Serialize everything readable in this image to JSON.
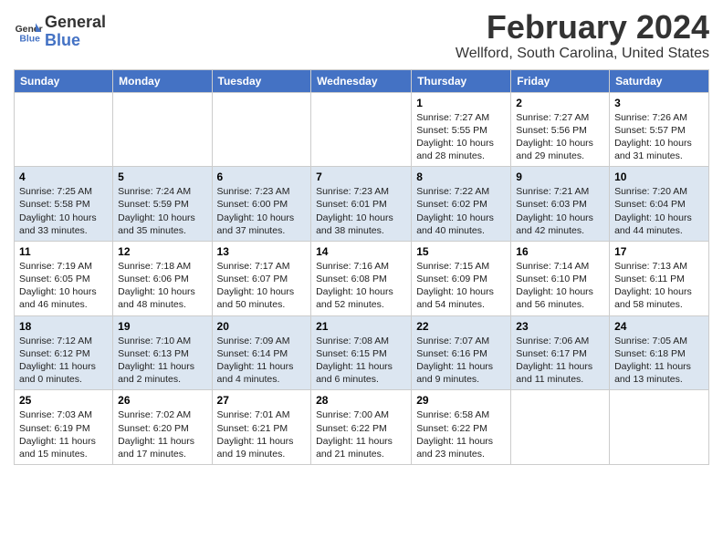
{
  "header": {
    "logo_line1": "General",
    "logo_line2": "Blue",
    "month": "February 2024",
    "location": "Wellford, South Carolina, United States"
  },
  "days_of_week": [
    "Sunday",
    "Monday",
    "Tuesday",
    "Wednesday",
    "Thursday",
    "Friday",
    "Saturday"
  ],
  "weeks": [
    [
      {
        "day": "",
        "content": ""
      },
      {
        "day": "",
        "content": ""
      },
      {
        "day": "",
        "content": ""
      },
      {
        "day": "",
        "content": ""
      },
      {
        "day": "1",
        "content": "Sunrise: 7:27 AM\nSunset: 5:55 PM\nDaylight: 10 hours and 28 minutes."
      },
      {
        "day": "2",
        "content": "Sunrise: 7:27 AM\nSunset: 5:56 PM\nDaylight: 10 hours and 29 minutes."
      },
      {
        "day": "3",
        "content": "Sunrise: 7:26 AM\nSunset: 5:57 PM\nDaylight: 10 hours and 31 minutes."
      }
    ],
    [
      {
        "day": "4",
        "content": "Sunrise: 7:25 AM\nSunset: 5:58 PM\nDaylight: 10 hours and 33 minutes."
      },
      {
        "day": "5",
        "content": "Sunrise: 7:24 AM\nSunset: 5:59 PM\nDaylight: 10 hours and 35 minutes."
      },
      {
        "day": "6",
        "content": "Sunrise: 7:23 AM\nSunset: 6:00 PM\nDaylight: 10 hours and 37 minutes."
      },
      {
        "day": "7",
        "content": "Sunrise: 7:23 AM\nSunset: 6:01 PM\nDaylight: 10 hours and 38 minutes."
      },
      {
        "day": "8",
        "content": "Sunrise: 7:22 AM\nSunset: 6:02 PM\nDaylight: 10 hours and 40 minutes."
      },
      {
        "day": "9",
        "content": "Sunrise: 7:21 AM\nSunset: 6:03 PM\nDaylight: 10 hours and 42 minutes."
      },
      {
        "day": "10",
        "content": "Sunrise: 7:20 AM\nSunset: 6:04 PM\nDaylight: 10 hours and 44 minutes."
      }
    ],
    [
      {
        "day": "11",
        "content": "Sunrise: 7:19 AM\nSunset: 6:05 PM\nDaylight: 10 hours and 46 minutes."
      },
      {
        "day": "12",
        "content": "Sunrise: 7:18 AM\nSunset: 6:06 PM\nDaylight: 10 hours and 48 minutes."
      },
      {
        "day": "13",
        "content": "Sunrise: 7:17 AM\nSunset: 6:07 PM\nDaylight: 10 hours and 50 minutes."
      },
      {
        "day": "14",
        "content": "Sunrise: 7:16 AM\nSunset: 6:08 PM\nDaylight: 10 hours and 52 minutes."
      },
      {
        "day": "15",
        "content": "Sunrise: 7:15 AM\nSunset: 6:09 PM\nDaylight: 10 hours and 54 minutes."
      },
      {
        "day": "16",
        "content": "Sunrise: 7:14 AM\nSunset: 6:10 PM\nDaylight: 10 hours and 56 minutes."
      },
      {
        "day": "17",
        "content": "Sunrise: 7:13 AM\nSunset: 6:11 PM\nDaylight: 10 hours and 58 minutes."
      }
    ],
    [
      {
        "day": "18",
        "content": "Sunrise: 7:12 AM\nSunset: 6:12 PM\nDaylight: 11 hours and 0 minutes."
      },
      {
        "day": "19",
        "content": "Sunrise: 7:10 AM\nSunset: 6:13 PM\nDaylight: 11 hours and 2 minutes."
      },
      {
        "day": "20",
        "content": "Sunrise: 7:09 AM\nSunset: 6:14 PM\nDaylight: 11 hours and 4 minutes."
      },
      {
        "day": "21",
        "content": "Sunrise: 7:08 AM\nSunset: 6:15 PM\nDaylight: 11 hours and 6 minutes."
      },
      {
        "day": "22",
        "content": "Sunrise: 7:07 AM\nSunset: 6:16 PM\nDaylight: 11 hours and 9 minutes."
      },
      {
        "day": "23",
        "content": "Sunrise: 7:06 AM\nSunset: 6:17 PM\nDaylight: 11 hours and 11 minutes."
      },
      {
        "day": "24",
        "content": "Sunrise: 7:05 AM\nSunset: 6:18 PM\nDaylight: 11 hours and 13 minutes."
      }
    ],
    [
      {
        "day": "25",
        "content": "Sunrise: 7:03 AM\nSunset: 6:19 PM\nDaylight: 11 hours and 15 minutes."
      },
      {
        "day": "26",
        "content": "Sunrise: 7:02 AM\nSunset: 6:20 PM\nDaylight: 11 hours and 17 minutes."
      },
      {
        "day": "27",
        "content": "Sunrise: 7:01 AM\nSunset: 6:21 PM\nDaylight: 11 hours and 19 minutes."
      },
      {
        "day": "28",
        "content": "Sunrise: 7:00 AM\nSunset: 6:22 PM\nDaylight: 11 hours and 21 minutes."
      },
      {
        "day": "29",
        "content": "Sunrise: 6:58 AM\nSunset: 6:22 PM\nDaylight: 11 hours and 23 minutes."
      },
      {
        "day": "",
        "content": ""
      },
      {
        "day": "",
        "content": ""
      }
    ]
  ]
}
